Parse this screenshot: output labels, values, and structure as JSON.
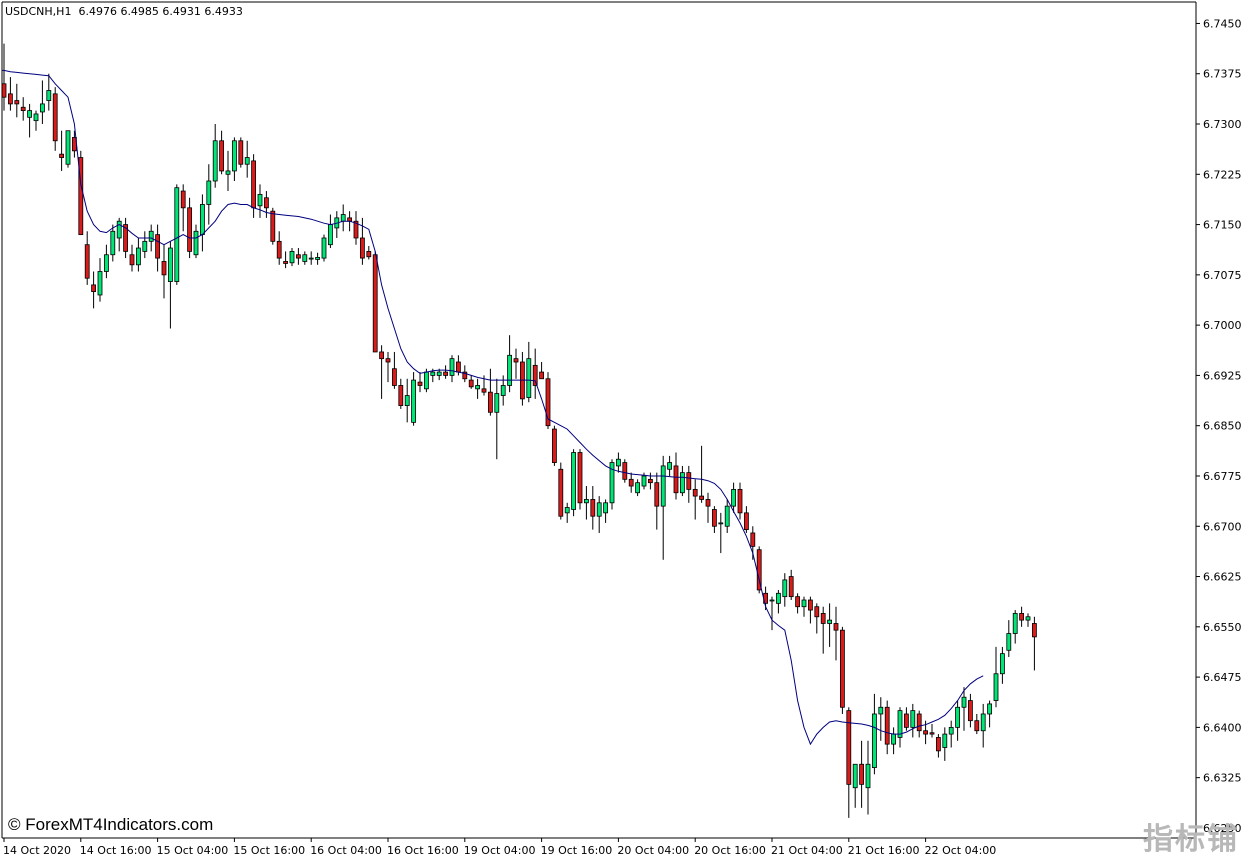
{
  "header": {
    "symbol": "USDCNH,H1",
    "ohlc": "6.4976 6.4985 6.4931 6.4933"
  },
  "watermark": "© ForexMT4Indicators.com",
  "brand_text": "指标铺",
  "colors": {
    "background": "#ffffff",
    "bull": "#00e676",
    "bear": "#d81b1b",
    "wick": "#000000",
    "ma_line": "#000080",
    "axis": "#000000"
  },
  "chart_data": {
    "type": "candlestick",
    "timeframe": "H1",
    "ylim": [
      6.6235,
      6.7482
    ],
    "y_ticks": [
      "6.7450",
      "6.7375",
      "6.7300",
      "6.7225",
      "6.7150",
      "6.7075",
      "6.7000",
      "6.6925",
      "6.6850",
      "6.6775",
      "6.6700",
      "6.6625",
      "6.6550",
      "6.6475",
      "6.6400",
      "6.6325",
      "6.6250"
    ],
    "x_tick_labels": [
      "14 Oct 2020",
      "14 Oct 16:00",
      "15 Oct 04:00",
      "15 Oct 16:00",
      "16 Oct 04:00",
      "16 Oct 16:00",
      "19 Oct 04:00",
      "19 Oct 16:00",
      "20 Oct 04:00",
      "20 Oct 16:00",
      "21 Oct 04:00",
      "21 Oct 16:00",
      "22 Oct 04:00"
    ],
    "x_tick_bar_index": [
      0,
      12,
      24,
      36,
      48,
      60,
      72,
      84,
      96,
      108,
      120,
      132,
      144
    ],
    "candles": [
      [
        6.736,
        6.742,
        6.732,
        6.734
      ],
      [
        6.7345,
        6.737,
        6.732,
        6.733
      ],
      [
        6.7335,
        6.736,
        6.731,
        6.733
      ],
      [
        6.7325,
        6.734,
        6.7305,
        6.732
      ],
      [
        6.731,
        6.733,
        6.728,
        6.732
      ],
      [
        6.7305,
        6.732,
        6.729,
        6.7315
      ],
      [
        6.7318,
        6.7365,
        6.73,
        6.733
      ],
      [
        6.7335,
        6.7375,
        6.732,
        6.735
      ],
      [
        6.7345,
        6.7355,
        6.726,
        6.7275
      ],
      [
        6.7255,
        6.729,
        6.723,
        6.725
      ],
      [
        6.724,
        6.728,
        6.7235,
        6.729
      ],
      [
        6.728,
        6.729,
        6.725,
        6.726
      ],
      [
        6.725,
        6.726,
        6.714,
        6.7135
      ],
      [
        6.712,
        6.714,
        6.706,
        6.707
      ],
      [
        6.706,
        6.708,
        6.7025,
        6.705
      ],
      [
        6.7045,
        6.71,
        6.7035,
        6.708
      ],
      [
        6.708,
        6.712,
        6.707,
        6.7105
      ],
      [
        6.7105,
        6.715,
        6.7095,
        6.714
      ],
      [
        6.713,
        6.716,
        6.711,
        6.7155
      ],
      [
        6.715,
        6.716,
        6.71,
        6.711
      ],
      [
        6.7105,
        6.712,
        6.708,
        6.709
      ],
      [
        6.709,
        6.713,
        6.708,
        6.7115
      ],
      [
        6.711,
        6.714,
        6.71,
        6.7125
      ],
      [
        6.7125,
        6.715,
        6.711,
        6.714
      ],
      [
        6.7135,
        6.715,
        6.708,
        6.71
      ],
      [
        6.7095,
        6.712,
        6.704,
        6.7075
      ],
      [
        6.7065,
        6.7125,
        6.6995,
        6.7115
      ],
      [
        6.7065,
        6.721,
        6.706,
        6.7205
      ],
      [
        6.72,
        6.721,
        6.714,
        6.7175
      ],
      [
        6.7175,
        6.719,
        6.71,
        6.711
      ],
      [
        6.7105,
        6.715,
        6.71,
        6.714
      ],
      [
        6.7135,
        6.7195,
        6.711,
        6.718
      ],
      [
        6.718,
        6.724,
        6.715,
        6.7215
      ],
      [
        6.7215,
        6.73,
        6.7205,
        6.7275
      ],
      [
        6.7275,
        6.729,
        6.7225,
        6.723
      ],
      [
        6.7225,
        6.726,
        6.72,
        6.723
      ],
      [
        6.723,
        6.728,
        6.7215,
        6.7275
      ],
      [
        6.7275,
        6.728,
        6.7235,
        6.724
      ],
      [
        6.724,
        6.7275,
        6.722,
        6.725
      ],
      [
        6.7245,
        6.7255,
        6.716,
        6.7175
      ],
      [
        6.7178,
        6.721,
        6.716,
        6.7195
      ],
      [
        6.719,
        6.72,
        6.716,
        6.7175
      ],
      [
        6.717,
        6.7175,
        6.712,
        6.7125
      ],
      [
        6.7125,
        6.714,
        6.709,
        6.71
      ],
      [
        6.7095,
        6.711,
        6.7085,
        6.7092
      ],
      [
        6.7093,
        6.7115,
        6.7088,
        6.711
      ],
      [
        6.7105,
        6.7115,
        6.709,
        6.71
      ],
      [
        6.7095,
        6.711,
        6.709,
        6.7105
      ],
      [
        6.71,
        6.711,
        6.709,
        6.71
      ],
      [
        6.7098,
        6.7108,
        6.709,
        6.7101
      ],
      [
        6.71,
        6.7135,
        6.7095,
        6.713
      ],
      [
        6.712,
        6.7165,
        6.7115,
        6.715
      ],
      [
        6.7145,
        6.717,
        6.713,
        6.716
      ],
      [
        6.7155,
        6.718,
        6.714,
        6.7165
      ],
      [
        6.716,
        6.717,
        6.714,
        6.7155
      ],
      [
        6.7155,
        6.717,
        6.712,
        6.713
      ],
      [
        6.713,
        6.716,
        6.709,
        6.71
      ],
      [
        6.711,
        6.7118,
        6.7098,
        6.7102
      ],
      [
        6.7105,
        6.711,
        6.696,
        6.696
      ],
      [
        6.696,
        6.697,
        6.689,
        6.695
      ],
      [
        6.695,
        6.696,
        6.6915,
        6.6945
      ],
      [
        6.6935,
        6.696,
        6.6905,
        6.691
      ],
      [
        6.691,
        6.692,
        6.6875,
        6.688
      ],
      [
        6.688,
        6.692,
        6.6855,
        6.6895
      ],
      [
        6.6855,
        6.693,
        6.685,
        6.6918
      ],
      [
        6.6915,
        6.693,
        6.69,
        6.691
      ],
      [
        6.6905,
        6.6935,
        6.69,
        6.693
      ],
      [
        6.6925,
        6.6935,
        6.6915,
        6.693
      ],
      [
        6.6925,
        6.6935,
        6.6918,
        6.693
      ],
      [
        6.693,
        6.694,
        6.692,
        6.6925
      ],
      [
        6.6925,
        6.6955,
        6.6915,
        6.695
      ],
      [
        6.6945,
        6.6955,
        6.6925,
        6.693
      ],
      [
        6.693,
        6.694,
        6.6915,
        6.692
      ],
      [
        6.6918,
        6.6925,
        6.6905,
        6.6908
      ],
      [
        6.6905,
        6.692,
        6.689,
        6.691
      ],
      [
        6.6905,
        6.6925,
        6.6895,
        6.69
      ],
      [
        6.69,
        6.6935,
        6.6865,
        6.687
      ],
      [
        6.687,
        6.692,
        6.68,
        6.6898
      ],
      [
        6.6895,
        6.6925,
        6.688,
        6.691
      ],
      [
        6.691,
        6.6985,
        6.69,
        6.6955
      ],
      [
        6.695,
        6.6965,
        6.692,
        6.6945
      ],
      [
        6.6945,
        6.696,
        6.688,
        6.689
      ],
      [
        6.6892,
        6.6975,
        6.6885,
        6.695
      ],
      [
        6.694,
        6.6965,
        6.689,
        6.691
      ],
      [
        6.693,
        6.6945,
        6.692,
        6.692
      ],
      [
        6.692,
        6.693,
        6.6845,
        6.685
      ],
      [
        6.6845,
        6.685,
        6.679,
        6.6795
      ],
      [
        6.6785,
        6.6795,
        6.671,
        6.6715
      ],
      [
        6.672,
        6.6735,
        6.6705,
        6.6728
      ],
      [
        6.6725,
        6.6815,
        6.6715,
        6.681
      ],
      [
        6.681,
        6.6815,
        6.6725,
        6.6735
      ],
      [
        6.6735,
        6.676,
        6.671,
        6.674
      ],
      [
        6.674,
        6.676,
        6.6695,
        6.6715
      ],
      [
        6.6715,
        6.6745,
        6.669,
        6.6735
      ],
      [
        6.672,
        6.674,
        6.6705,
        6.6735
      ],
      [
        6.6735,
        6.68,
        6.6725,
        6.6795
      ],
      [
        6.679,
        6.681,
        6.678,
        6.68
      ],
      [
        6.6795,
        6.68,
        6.6765,
        6.677
      ],
      [
        6.677,
        6.678,
        6.675,
        6.676
      ],
      [
        6.675,
        6.677,
        6.6745,
        6.6765
      ],
      [
        6.676,
        6.678,
        6.6755,
        6.6775
      ],
      [
        6.677,
        6.678,
        6.6755,
        6.6765
      ],
      [
        6.6765,
        6.678,
        6.6695,
        6.673
      ],
      [
        6.673,
        6.6805,
        6.665,
        6.679
      ],
      [
        6.6785,
        6.6805,
        6.6775,
        6.6795
      ],
      [
        6.679,
        6.681,
        6.674,
        6.675
      ],
      [
        6.675,
        6.679,
        6.6745,
        6.678
      ],
      [
        6.678,
        6.679,
        6.6735,
        6.6755
      ],
      [
        6.6755,
        6.677,
        6.671,
        6.6745
      ],
      [
        6.6745,
        6.682,
        6.6735,
        6.674
      ],
      [
        6.674,
        6.675,
        6.6705,
        6.673
      ],
      [
        6.6725,
        6.673,
        6.669,
        6.67
      ],
      [
        6.6705,
        6.672,
        6.666,
        6.6705
      ],
      [
        6.67,
        6.674,
        6.669,
        6.673
      ],
      [
        6.673,
        6.6765,
        6.672,
        6.6755
      ],
      [
        6.6755,
        6.6765,
        6.671,
        6.672
      ],
      [
        6.672,
        6.673,
        6.669,
        6.6695
      ],
      [
        6.669,
        6.67,
        6.665,
        6.667
      ],
      [
        6.6665,
        6.667,
        6.66,
        6.6605
      ],
      [
        6.66,
        6.661,
        6.6575,
        6.6585
      ],
      [
        6.659,
        6.6595,
        6.6545,
        6.659
      ],
      [
        6.6585,
        6.6605,
        6.657,
        6.66
      ],
      [
        6.6595,
        6.663,
        6.658,
        6.662
      ],
      [
        6.6625,
        6.6635,
        6.659,
        6.6595
      ],
      [
        6.6595,
        6.66,
        6.657,
        6.658
      ],
      [
        6.658,
        6.6595,
        6.6565,
        6.659
      ],
      [
        6.659,
        6.6595,
        6.6555,
        6.6575
      ],
      [
        6.658,
        6.6585,
        6.654,
        6.6565
      ],
      [
        6.657,
        6.658,
        6.651,
        6.6555
      ],
      [
        6.6555,
        6.6585,
        6.652,
        6.656
      ],
      [
        6.6555,
        6.658,
        6.65,
        6.6545
      ],
      [
        6.6545,
        6.655,
        6.642,
        6.643
      ],
      [
        6.6425,
        6.643,
        6.6265,
        6.6315
      ],
      [
        6.631,
        6.6335,
        6.628,
        6.6345
      ],
      [
        6.6345,
        6.638,
        6.628,
        6.6315
      ],
      [
        6.631,
        6.638,
        6.627,
        6.6345
      ],
      [
        6.634,
        6.645,
        6.633,
        6.642
      ],
      [
        6.642,
        6.6445,
        6.638,
        6.643
      ],
      [
        6.643,
        6.644,
        6.636,
        6.6375
      ],
      [
        6.6375,
        6.64,
        6.636,
        6.639
      ],
      [
        6.6385,
        6.643,
        6.637,
        6.6425
      ],
      [
        6.642,
        6.643,
        6.6395,
        6.64
      ],
      [
        6.64,
        6.6435,
        6.6385,
        6.6425
      ],
      [
        6.642,
        6.6425,
        6.6385,
        6.6395
      ],
      [
        6.6395,
        6.641,
        6.6375,
        6.639
      ],
      [
        6.6392,
        6.6405,
        6.6385,
        6.639
      ],
      [
        6.6385,
        6.639,
        6.6355,
        6.6365
      ],
      [
        6.637,
        6.64,
        6.635,
        6.639
      ],
      [
        6.639,
        6.641,
        6.637,
        6.64
      ],
      [
        6.64,
        6.644,
        6.638,
        6.643
      ],
      [
        6.643,
        6.646,
        6.6395,
        6.6445
      ],
      [
        6.644,
        6.645,
        6.64,
        6.641
      ],
      [
        6.641,
        6.642,
        6.639,
        6.6395
      ],
      [
        6.6395,
        6.6435,
        6.637,
        6.642
      ],
      [
        6.642,
        6.644,
        6.64,
        6.6435
      ],
      [
        6.644,
        6.652,
        6.643,
        6.648
      ],
      [
        6.648,
        6.652,
        6.6465,
        6.651
      ],
      [
        6.6515,
        6.656,
        6.6505,
        6.654
      ],
      [
        6.654,
        6.6575,
        6.6525,
        6.657
      ],
      [
        6.657,
        6.658,
        6.655,
        6.656
      ],
      [
        6.656,
        6.657,
        6.655,
        6.6565
      ],
      [
        6.6555,
        6.6565,
        6.6485,
        6.6535
      ]
    ],
    "ma": [
      6.738,
      6.7378,
      6.7377,
      6.7376,
      6.7375,
      6.7374,
      6.7373,
      6.7372,
      6.736,
      6.735,
      6.734,
      6.73,
      6.721,
      6.717,
      6.715,
      6.714,
      6.7138,
      6.7145,
      6.715,
      6.7145,
      6.7137,
      6.713,
      6.713,
      6.713,
      6.7125,
      6.712,
      6.7125,
      6.713,
      6.7135,
      6.713,
      6.713,
      6.7135,
      6.7145,
      6.7155,
      6.717,
      6.718,
      6.7182,
      6.718,
      6.718,
      6.7175,
      6.7172,
      6.7168,
      6.7166,
      6.7165,
      6.7164,
      6.7163,
      6.7162,
      6.716,
      6.7158,
      6.7155,
      6.7152,
      6.715,
      6.7152,
      6.7155,
      6.7155,
      6.7152,
      6.7148,
      6.7143,
      6.711,
      6.706,
      6.7025,
      6.6995,
      6.6965,
      6.6945,
      6.6935,
      6.6928,
      6.693,
      6.6932,
      6.6933,
      6.6933,
      6.6932,
      6.693,
      6.6928,
      6.6925,
      6.6922,
      6.692,
      6.6918,
      6.6918,
      6.6918,
      6.6918,
      6.6918,
      6.6918,
      6.6918,
      6.6917,
      6.689,
      6.686,
      6.6855,
      6.685,
      6.6845,
      6.6835,
      6.6825,
      6.6815,
      6.6806,
      6.6798,
      6.679,
      6.6785,
      6.6782,
      6.678,
      6.6778,
      6.6777,
      6.6776,
      6.6775,
      6.6775,
      6.6775,
      6.6774,
      6.6773,
      6.6773,
      6.6772,
      6.6771,
      6.677,
      6.6768,
      6.6764,
      6.6755,
      6.674,
      6.6722,
      6.6705,
      6.6685,
      6.666,
      6.662,
      6.658,
      6.656,
      6.6552,
      6.6545,
      6.65,
      6.644,
      6.64,
      6.6375,
      6.639,
      6.64,
      6.6408,
      6.641,
      6.6408,
      6.6407,
      6.6406,
      6.6405,
      6.6403,
      6.64,
      6.6395,
      6.6392,
      6.639,
      6.639,
      6.6393,
      6.6398,
      6.6402,
      6.6404,
      6.6408,
      6.6412,
      6.6418,
      6.6428,
      6.644,
      6.6455,
      6.6465,
      6.6472,
      6.6477
    ]
  }
}
